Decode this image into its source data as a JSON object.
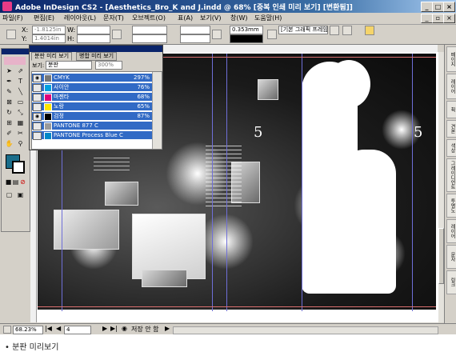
{
  "window": {
    "title": "Adobe InDesign CS2 - [Aesthetics_Bro_K and J.indd @ 68% [중복 인쇄 미리 보기] [변환됨]]",
    "controls": [
      "_",
      "□",
      "×"
    ]
  },
  "menu": [
    "파일(F)",
    "편집(E)",
    "레이아웃(L)",
    "문자(T)",
    "오브젝트(O)",
    "표(A)",
    "보기(V)",
    "창(W)",
    "도움말(H)"
  ],
  "control_panel": {
    "x_label": "X:",
    "x_value": "-1.8125in",
    "y_label": "Y:",
    "y_value": "1.4014in",
    "w_label": "W:",
    "h_label": "H:",
    "stroke_weight": "0.353mm",
    "style_field": "[기본 그래픽 프레임]"
  },
  "separations_panel": {
    "tabs": [
      "분판 미리 보기",
      "병합 미리 보기"
    ],
    "view_label": "보기:",
    "view_value": "분판",
    "zoom_value": "300%",
    "inks": [
      {
        "name": "CMYK",
        "percent": "297%",
        "color": "#777777",
        "eye": true
      },
      {
        "name": "사이안",
        "percent": "76%",
        "color": "#00a0e0",
        "eye": false
      },
      {
        "name": "마젠타",
        "percent": "68%",
        "color": "#e0007a",
        "eye": false
      },
      {
        "name": "노랑",
        "percent": "65%",
        "color": "#ffe600",
        "eye": false
      },
      {
        "name": "검정",
        "percent": "87%",
        "color": "#000000",
        "eye": true
      },
      {
        "name": "PANTONE 877 C",
        "percent": "",
        "color": "#9a9a9a",
        "eye": false
      },
      {
        "name": "PANTONE Process Blue C",
        "percent": "",
        "color": "#0088c7",
        "eye": false
      }
    ]
  },
  "document": {
    "page_number": "5",
    "page_number_right": "5"
  },
  "right_dock_tabs": [
    "페이지",
    "레이어",
    "획",
    "견본",
    "색상",
    "그레이디언트",
    "투명도",
    "레이어",
    "문자",
    "링크"
  ],
  "status": {
    "zoom": "68.23%",
    "page": "4",
    "save_state": "저장 안 함"
  },
  "caption": "• 분판 미리보기"
}
